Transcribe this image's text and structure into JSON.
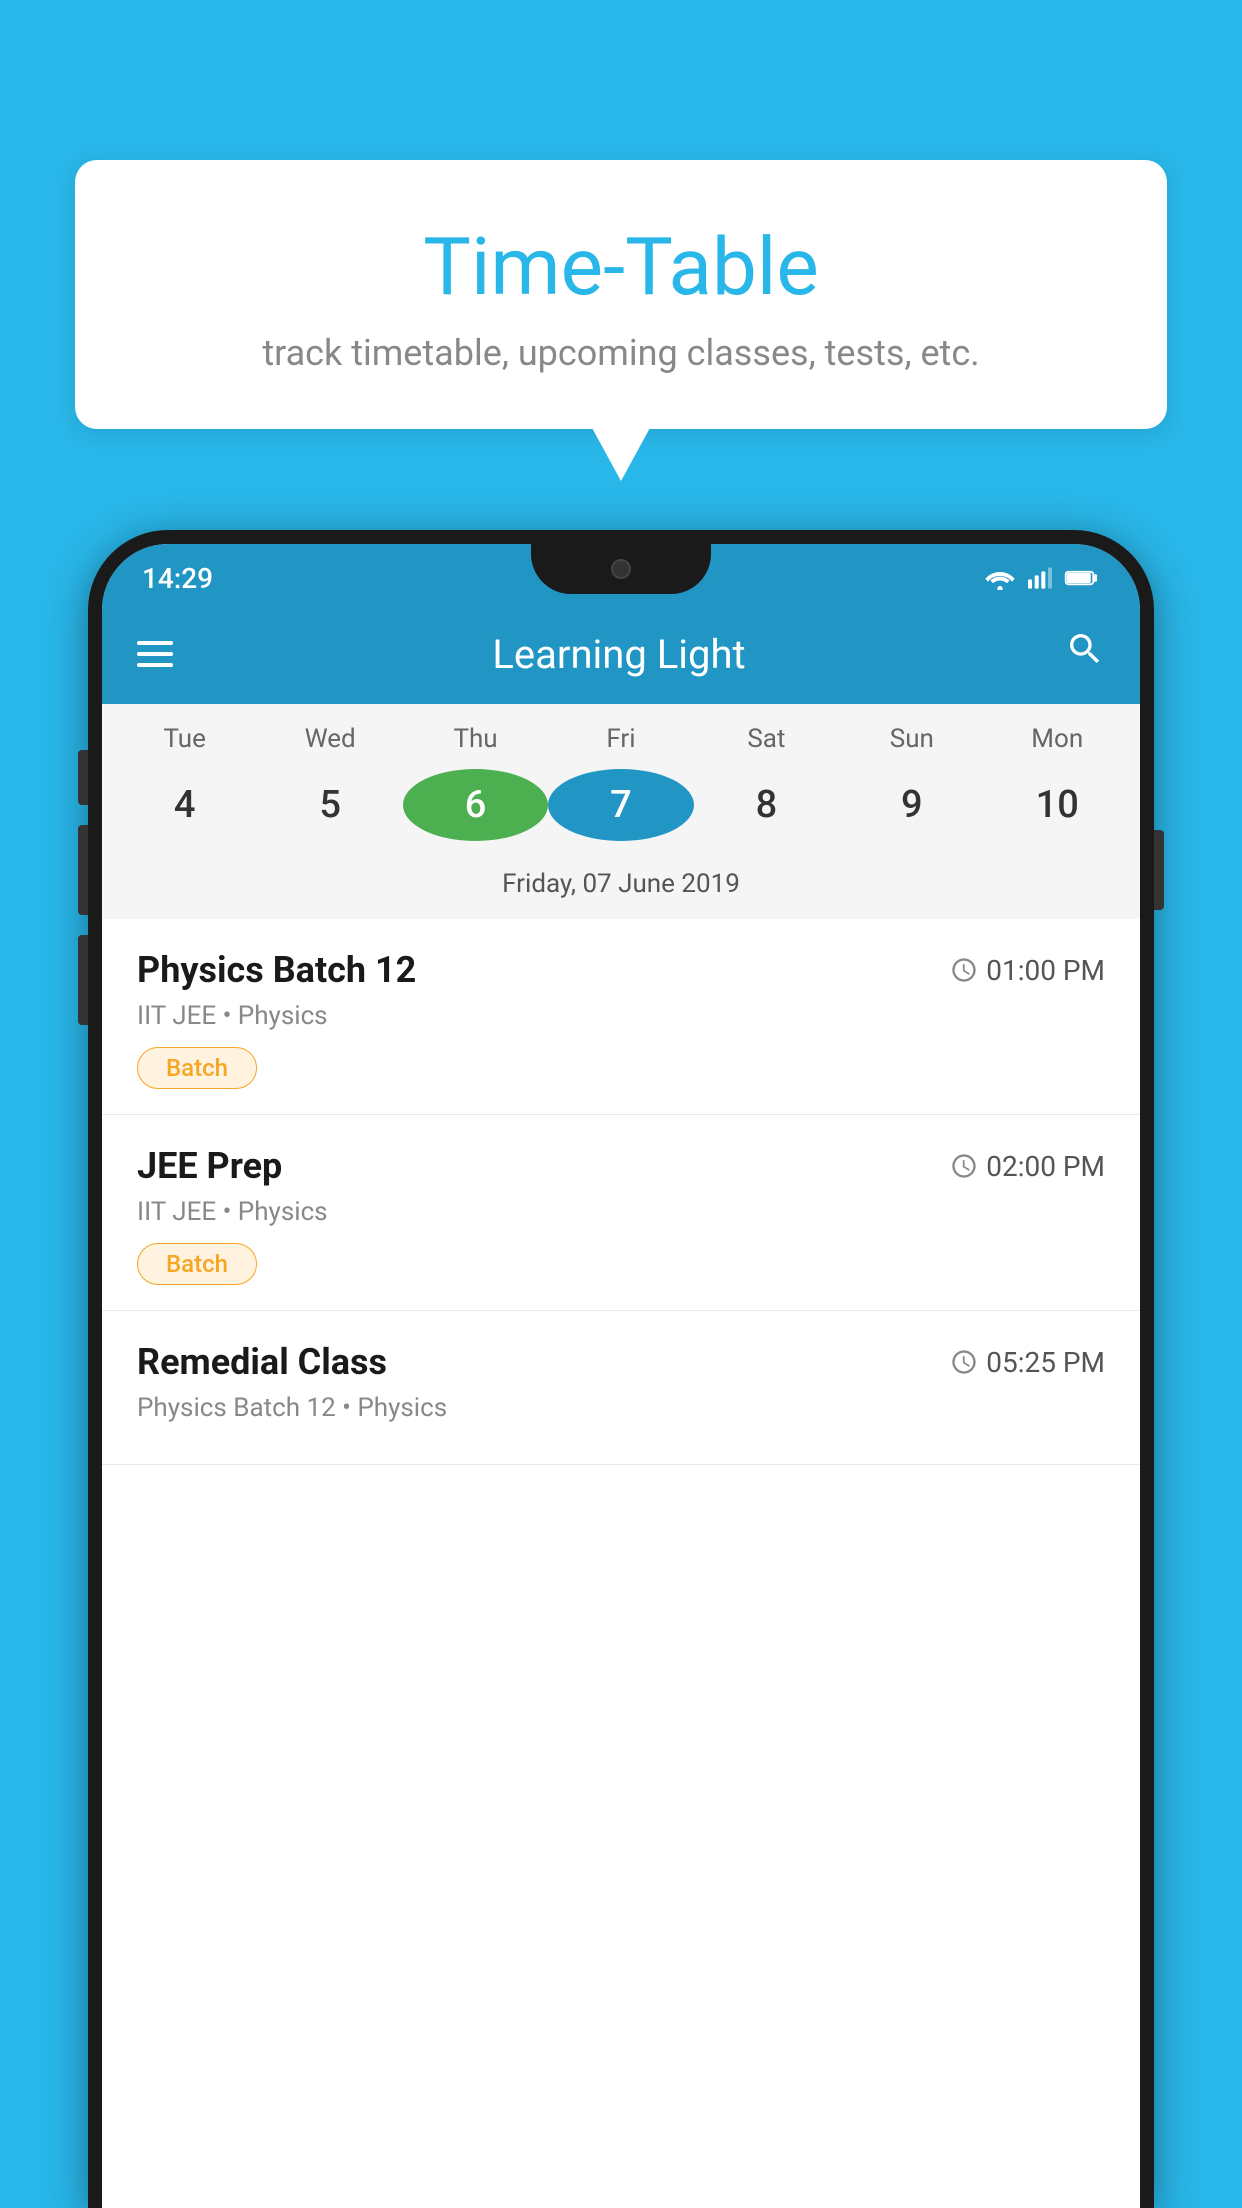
{
  "page": {
    "background_color": "#29b6e8"
  },
  "speech_bubble": {
    "title": "Time-Table",
    "subtitle": "track timetable, upcoming classes, tests, etc."
  },
  "phone": {
    "status_bar": {
      "time": "14:29"
    },
    "app_bar": {
      "title": "Learning Light",
      "menu_icon": "hamburger-icon",
      "search_icon": "search-icon"
    },
    "calendar": {
      "days": [
        "Tue",
        "Wed",
        "Thu",
        "Fri",
        "Sat",
        "Sun",
        "Mon"
      ],
      "dates": [
        "4",
        "5",
        "6",
        "7",
        "8",
        "9",
        "10"
      ],
      "today_index": 2,
      "selected_index": 3,
      "selected_date_label": "Friday, 07 June 2019"
    },
    "schedule_items": [
      {
        "title": "Physics Batch 12",
        "time": "01:00 PM",
        "subtitle": "IIT JEE • Physics",
        "tag": "Batch"
      },
      {
        "title": "JEE Prep",
        "time": "02:00 PM",
        "subtitle": "IIT JEE • Physics",
        "tag": "Batch"
      },
      {
        "title": "Remedial Class",
        "time": "05:25 PM",
        "subtitle": "Physics Batch 12 • Physics",
        "tag": null
      }
    ]
  }
}
